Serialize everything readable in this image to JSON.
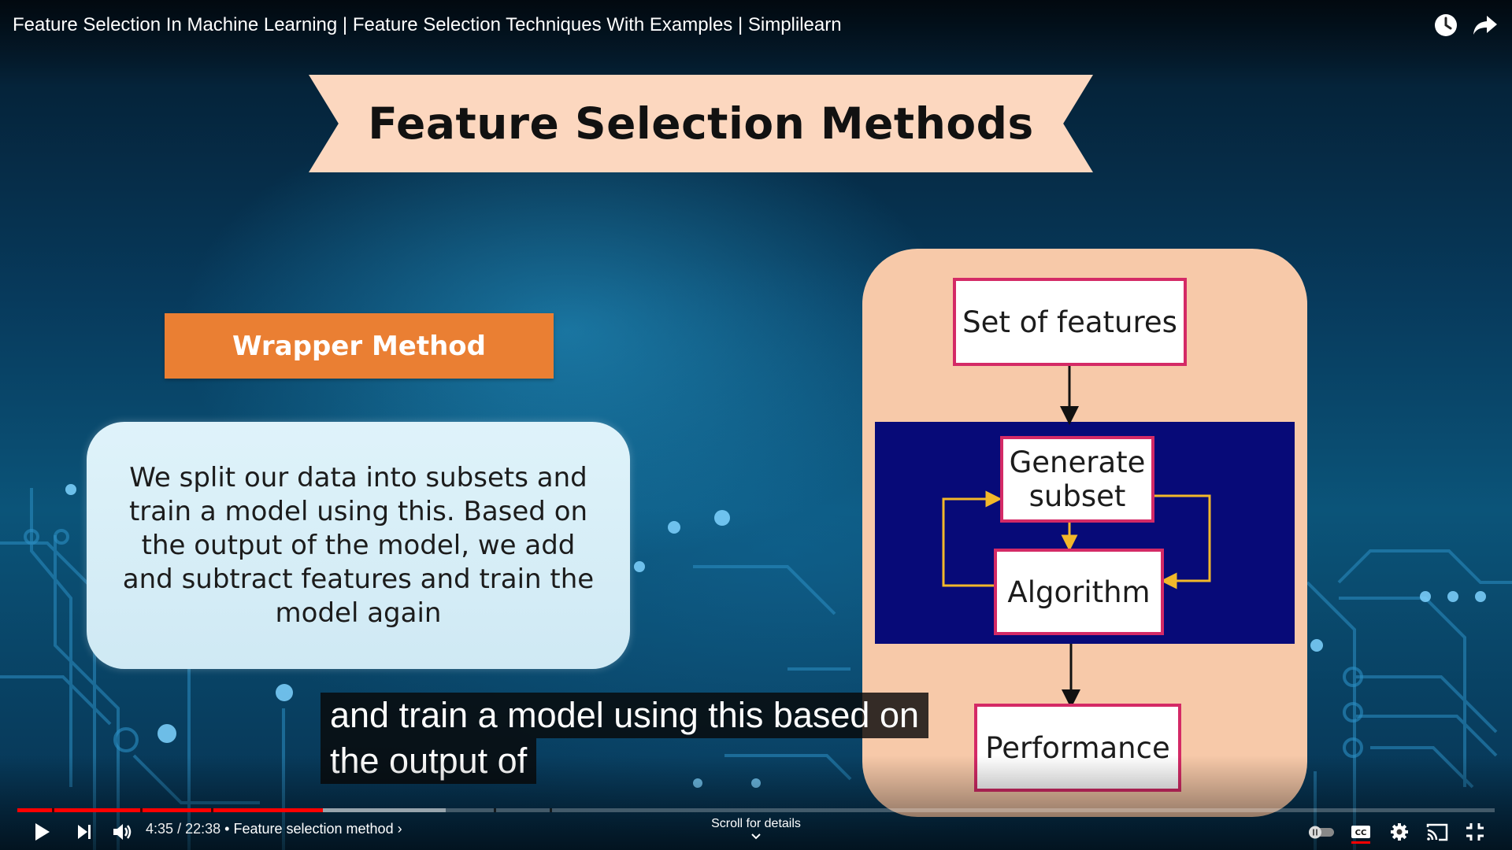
{
  "player": {
    "title": "Feature Selection In Machine Learning | Feature Selection Techniques With Examples | Simplilearn",
    "time_current": "4:35",
    "time_total": "22:38",
    "time_separator": "/",
    "chapter": "• Feature selection method ›",
    "scroll_hint": "Scroll for details",
    "progress_played": 0.207,
    "progress_buffered": 0.29,
    "accent_color": "#ff0000"
  },
  "slide": {
    "heading": "Feature Selection Methods",
    "method_label": "Wrapper Method",
    "description_lines": [
      "We split our data into subsets and",
      "train a model using this. Based on",
      "the output of the model, we add",
      "and subtract features and train the",
      "model again"
    ],
    "flow": {
      "set_of_features": "Set of features",
      "generate_subset_lines": [
        "Generate",
        "subset"
      ],
      "algorithm": "Algorithm",
      "performance": "Performance"
    }
  },
  "captions": {
    "line1": "and train a model using this based on",
    "line2": "the output of"
  },
  "icons": {
    "watch_later": "clock-icon",
    "share": "share-icon",
    "play": "play-icon",
    "next": "next-icon",
    "volume": "volume-icon",
    "autoplay": "autoplay-toggle-icon",
    "captions": "cc-icon",
    "settings": "gear-icon",
    "cast": "cast-icon",
    "exit_fullscreen": "exit-fullscreen-icon"
  }
}
